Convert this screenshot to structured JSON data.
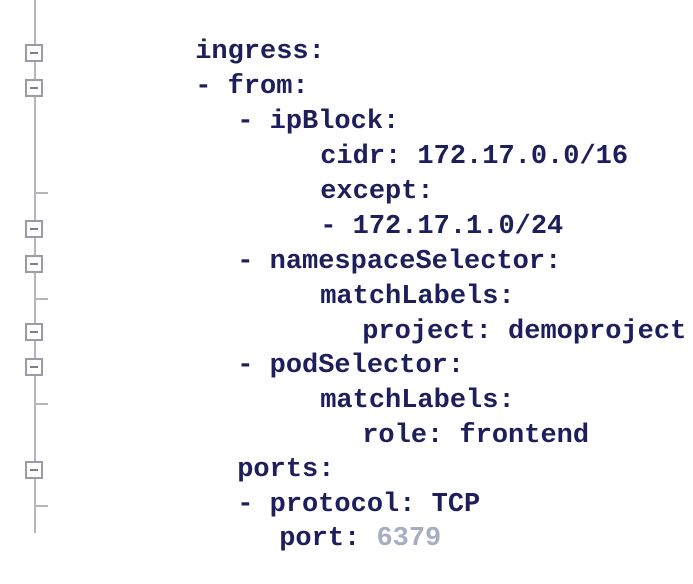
{
  "code_lines": [
    {
      "text": "ingress:",
      "muted": ""
    },
    {
      "text": "- from:",
      "muted": ""
    },
    {
      "text": "- ipBlock:",
      "muted": ""
    },
    {
      "text": "cidr: 172.17.0.0/16",
      "muted": ""
    },
    {
      "text": "except:",
      "muted": ""
    },
    {
      "text": "- 172.17.1.0/24",
      "muted": ""
    },
    {
      "text": "- namespaceSelector:",
      "muted": ""
    },
    {
      "text": "matchLabels:",
      "muted": ""
    },
    {
      "text": "project: demoproject",
      "muted": ""
    },
    {
      "text": "- podSelector:",
      "muted": ""
    },
    {
      "text": "matchLabels:",
      "muted": ""
    },
    {
      "text": "role: frontend",
      "muted": ""
    },
    {
      "text": "ports:",
      "muted": ""
    },
    {
      "text": "- protocol: TCP",
      "muted": ""
    },
    {
      "text": "port: ",
      "muted": "6379"
    }
  ],
  "colors": {
    "code_text": "#1e1e5c",
    "muted_text": "#a8aec2",
    "gutter_line": "#b5b5c0",
    "background": "#ffffff"
  }
}
